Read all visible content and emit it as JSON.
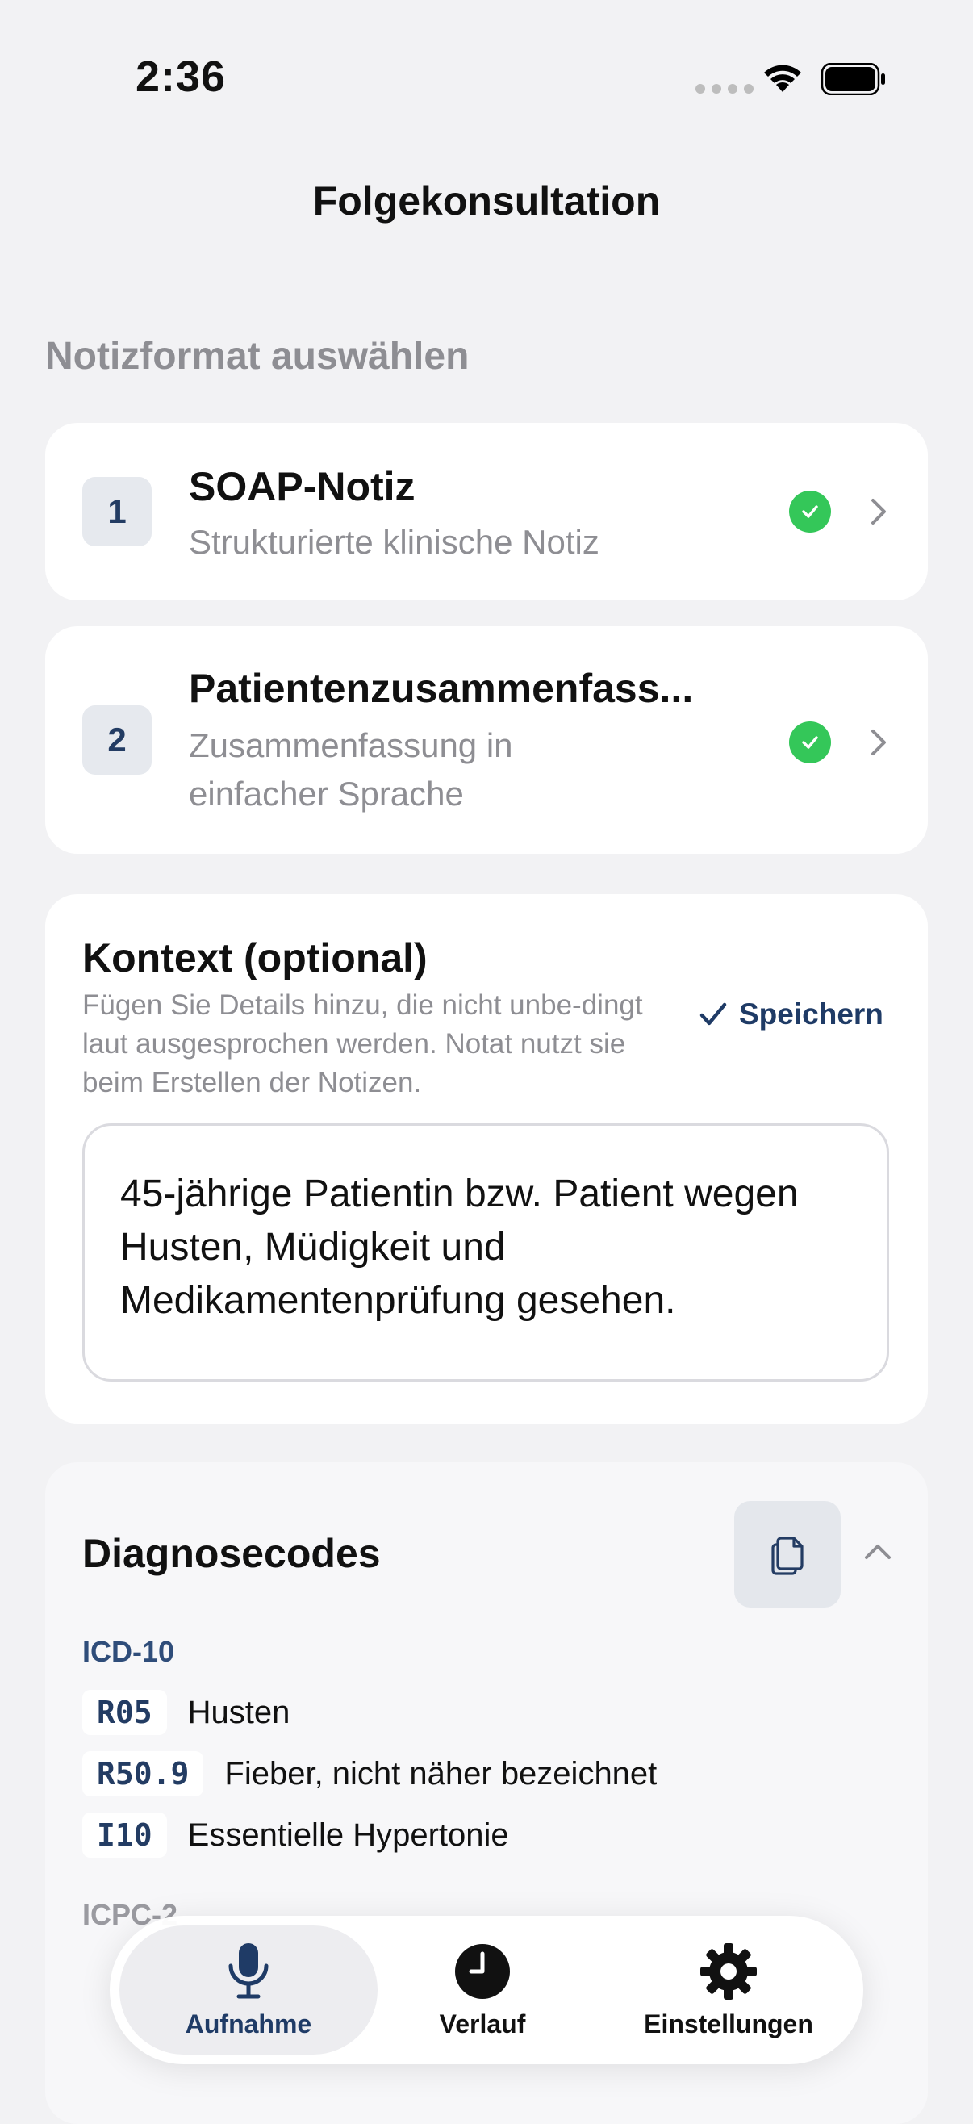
{
  "status_bar": {
    "time": "2:36"
  },
  "header": {
    "title": "Folgekonsultation"
  },
  "note_formats": {
    "section_label": "Notizformat auswählen",
    "items": [
      {
        "number": "1",
        "title": "SOAP-Notiz",
        "subtitle": "Strukturierte klinische Notiz"
      },
      {
        "number": "2",
        "title": "Patientenzusammenfass...",
        "subtitle": "Zusammenfassung in einfacher Sprache"
      }
    ]
  },
  "context": {
    "title": "Kontext (optional)",
    "description": "Fügen Sie Details hinzu, die nicht unbe-dingt laut ausgesprochen werden. Notat nutzt sie beim Erstellen der Notizen.",
    "save_label": "Speichern",
    "text": "45-jährige Patientin bzw. Patient wegen Husten, Müdigkeit und Medikamentenprüfung gesehen."
  },
  "diagnosis": {
    "title": "Diagnosecodes",
    "icd_label": "ICD-10",
    "icd_codes": [
      {
        "code": "R05",
        "description": "Husten"
      },
      {
        "code": "R50.9",
        "description": "Fieber, nicht näher bezeichnet"
      },
      {
        "code": "I10",
        "description": "Essentielle Hypertonie"
      }
    ],
    "icpc_label": "ICPC-2"
  },
  "tab_bar": {
    "tabs": [
      {
        "label": "Aufnahme",
        "icon": "microphone-icon",
        "active": true
      },
      {
        "label": "Verlauf",
        "icon": "clock-icon",
        "active": false
      },
      {
        "label": "Einstellungen",
        "icon": "gear-icon",
        "active": false
      }
    ]
  },
  "colors": {
    "accent": "#1F3B66",
    "success": "#34C759",
    "background": "#F2F2F4"
  }
}
